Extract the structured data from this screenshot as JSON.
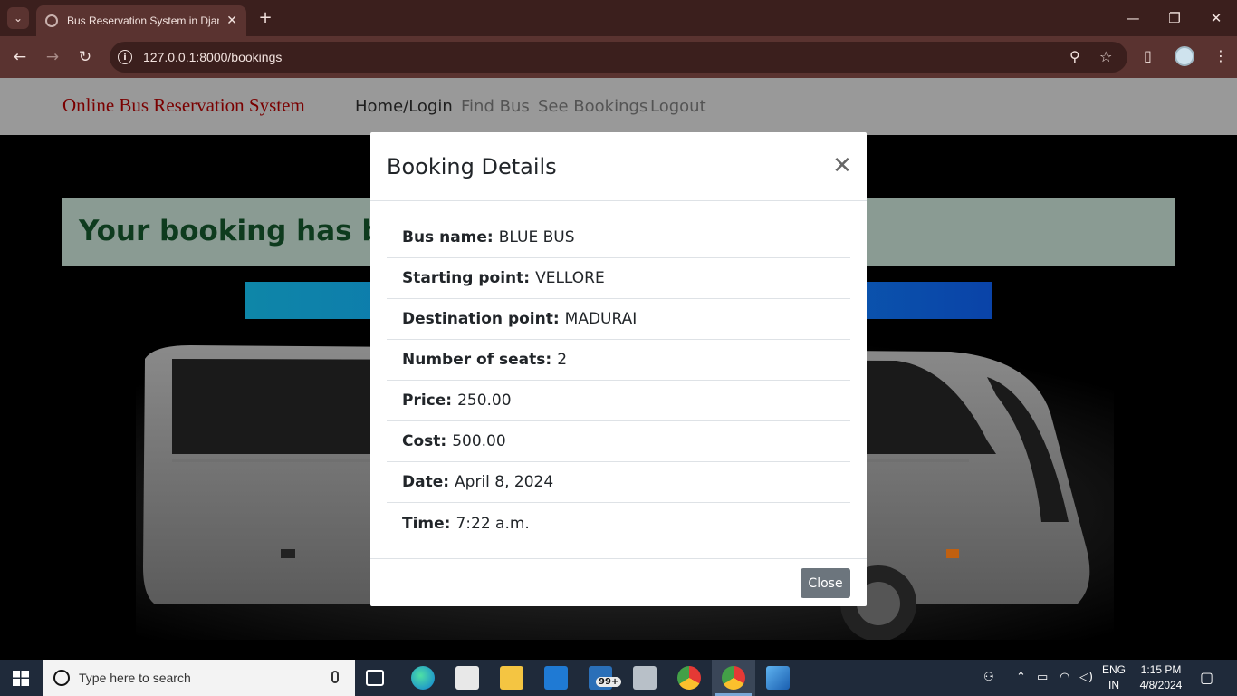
{
  "browser": {
    "tab_title": "Bus Reservation System in Djan",
    "tab_close": "✕",
    "new_tab": "+",
    "url": "127.0.0.1:8000/bookings",
    "win_min": "—",
    "win_restore": "❐",
    "win_close": "✕"
  },
  "site": {
    "brand": "Online Bus Reservation System",
    "nav": [
      "Home/Login",
      "Find Bus",
      "See Bookings",
      "Logout"
    ]
  },
  "alert": {
    "text": "Your booking has been"
  },
  "modal": {
    "title": "Booking Details",
    "close_x": "✕",
    "rows": [
      {
        "label": "Bus name:",
        "value": "BLUE BUS"
      },
      {
        "label": "Starting point:",
        "value": "VELLORE"
      },
      {
        "label": "Destination point:",
        "value": "MADURAI"
      },
      {
        "label": "Number of seats:",
        "value": "2"
      },
      {
        "label": "Price:",
        "value": "250.00"
      },
      {
        "label": "Cost:",
        "value": "500.00"
      },
      {
        "label": "Date:",
        "value": "April 8, 2024"
      },
      {
        "label": "Time:",
        "value": "7:22 a.m."
      }
    ],
    "close_button": "Close"
  },
  "taskbar": {
    "search_placeholder": "Type here to search",
    "mail_badge": "99+",
    "lang_top": "ENG",
    "lang_bottom": "IN",
    "time": "1:15 PM",
    "date": "4/8/2024"
  },
  "colors": {
    "brand": "#7a0000",
    "alert_bg": "#8a9b93",
    "alert_text": "#0e3b1e",
    "button_bar": "#0c6fb3",
    "close_button": "#6c757d"
  }
}
